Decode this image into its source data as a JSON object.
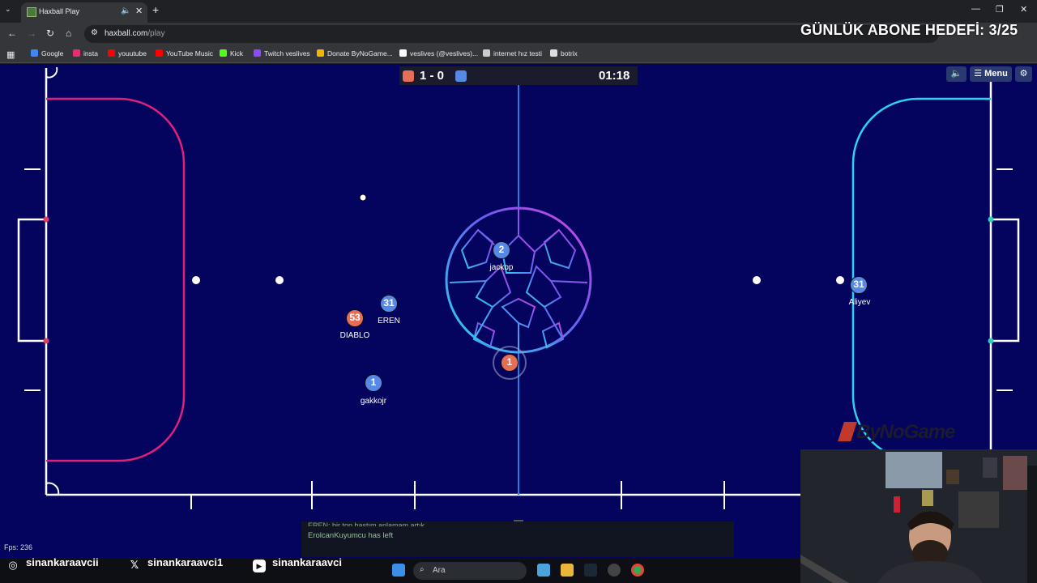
{
  "browser": {
    "tab_title": "Haxball Play",
    "url_host": "haxball.com",
    "url_path": "/play",
    "bookmarks": [
      {
        "label": "Google",
        "color": "#4285f4"
      },
      {
        "label": "insta",
        "color": "#e1306c"
      },
      {
        "label": "youutube",
        "color": "#ff0000"
      },
      {
        "label": "YouTube Music",
        "color": "#ff0000"
      },
      {
        "label": "Kick",
        "color": "#53fc18"
      },
      {
        "label": "Twitch veslives",
        "color": "#9146ff"
      },
      {
        "label": "Donate ByNoGame...",
        "color": "#f4b400"
      },
      {
        "label": "veslives (@veslives)...",
        "color": "#ffffff"
      },
      {
        "label": "internet hız testi",
        "color": "#cccccc"
      },
      {
        "label": "botrix",
        "color": "#dddddd"
      }
    ]
  },
  "overlay": {
    "goal_text": "GÜNLÜK ABONE HEDEFİ: 3/25",
    "watermark": "ByNoGame"
  },
  "game": {
    "score": "1 - 0",
    "timer": "01:18",
    "menu_label": "☰ Menu",
    "sound_icon": "speaker-icon",
    "settings_icon": "gear-icon",
    "fps": "Fps: 236",
    "colors": {
      "red": "#e56e56",
      "blue": "#5689e5",
      "field": "#04045e"
    },
    "players": [
      {
        "number": "2",
        "name": "jackop",
        "team": "blue"
      },
      {
        "number": "31",
        "name": "EREN",
        "team": "blue"
      },
      {
        "number": "53",
        "name": "DIABLO",
        "team": "red"
      },
      {
        "number": "1",
        "name": "gakkojr",
        "team": "blue"
      },
      {
        "number": "1",
        "name": "",
        "team": "red"
      },
      {
        "number": "31",
        "name": "Aliyev",
        "team": "blue"
      }
    ],
    "chat": {
      "partial_line": "EREN: bir top bastım anlamam artık",
      "last_line": "ErolcanKuyumcu has left"
    }
  },
  "social": {
    "instagram": "sinankaraavcii",
    "x": "sinankaraavci1",
    "youtube": "sinankaraavci"
  },
  "taskbar": {
    "search_placeholder": "Ara"
  }
}
